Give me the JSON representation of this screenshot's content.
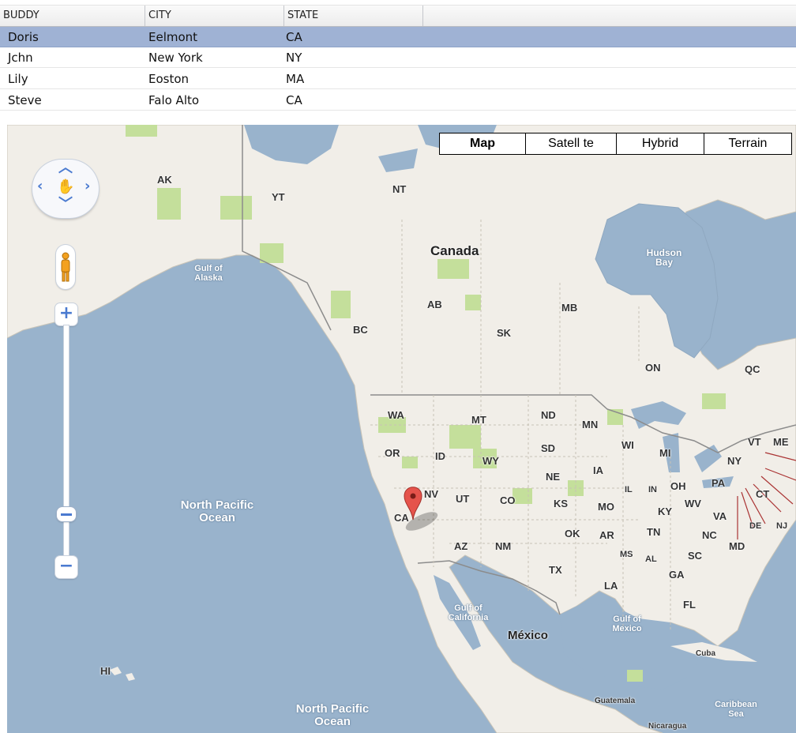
{
  "table": {
    "columns": [
      "BUDDY",
      "CITY",
      "STATE"
    ],
    "rows": [
      {
        "buddy": "Doris",
        "city": "Eelmont",
        "state": "CA",
        "selected": true
      },
      {
        "buddy": "Jchn",
        "city": "New York",
        "state": "NY",
        "selected": false
      },
      {
        "buddy": "Lily",
        "city": "Eoston",
        "state": "MA",
        "selected": false
      },
      {
        "buddy": "Steve",
        "city": "Falo Alto",
        "state": "CA",
        "selected": false
      }
    ]
  },
  "map": {
    "map_types": [
      "Map",
      "Satell te",
      "Hybrid",
      "Terrain"
    ],
    "active_map_type": "Map",
    "marker": {
      "label": "CA",
      "color": "#e5534b"
    },
    "labels": {
      "ak": "AK",
      "yt": "YT",
      "nt": "NT",
      "canada": "Canada",
      "hudson_bay": "Hudson Bay",
      "gulf_of_alaska": "Gulf of Alaska",
      "ab": "AB",
      "mb": "MB",
      "bc": "BC",
      "sk": "SK",
      "on": "ON",
      "qc": "QC",
      "wa": "WA",
      "mt": "MT",
      "nd": "ND",
      "mn": "MN",
      "vt": "VT",
      "me": "ME",
      "wi": "WI",
      "mi": "MI",
      "ny": "NY",
      "or": "OR",
      "id": "ID",
      "sd": "SD",
      "wy": "WY",
      "ne": "NE",
      "ia": "IA",
      "pa": "PA",
      "ct": "CT",
      "il": "IL",
      "in": "IN",
      "oh": "OH",
      "nv": "NV",
      "ut": "UT",
      "co": "CO",
      "ks": "KS",
      "mo": "MO",
      "ky": "KY",
      "wv": "WV",
      "va": "VA",
      "de": "DE",
      "nj": "NJ",
      "md": "MD",
      "ok": "OK",
      "ar": "AR",
      "tn": "TN",
      "nc": "NC",
      "az": "AZ",
      "nm": "NM",
      "tx": "TX",
      "ms": "MS",
      "al": "AL",
      "ga": "GA",
      "sc": "SC",
      "la": "LA",
      "fl": "FL",
      "north_pacific_ocean": "North Pacific Ocean",
      "north_pacific_ocean_2": "North Pacific Ocean",
      "gulf_of_california": "Gulf of California",
      "mexico": "México",
      "gulf_of_mexico": "Gulf of Mexico",
      "cuba": "Cuba",
      "hi": "HI",
      "guatemala": "Guatemala",
      "caribbean_sea": "Caribbean Sea",
      "nicaragua": "Nicaragua"
    },
    "colors": {
      "water": "#99b3cc",
      "land": "#f1eee8",
      "park": "#c4df9b",
      "border": "#8c8c8c",
      "accent": "#4a7ad0"
    }
  }
}
